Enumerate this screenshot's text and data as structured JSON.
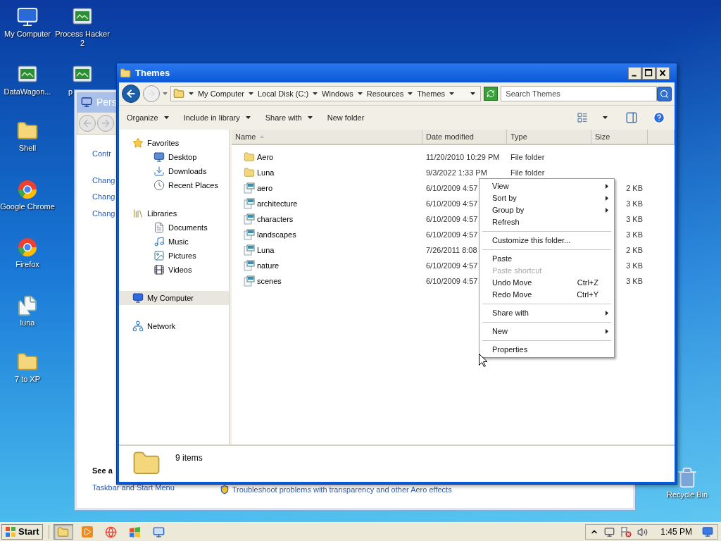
{
  "desktop_icons": [
    {
      "label": "My Computer",
      "kind": "computer"
    },
    {
      "label": "Process Hacker 2",
      "kind": "app"
    },
    {
      "label": "DataWagon...",
      "kind": "app"
    },
    {
      "label": "p",
      "kind": "app"
    },
    {
      "label": "Shell",
      "kind": "folder"
    },
    {
      "label": "Google Chrome",
      "kind": "browser"
    },
    {
      "label": "Firefox",
      "kind": "browser"
    },
    {
      "label": "luna",
      "kind": "files"
    },
    {
      "label": "7 to XP",
      "kind": "folder"
    },
    {
      "label": "Recycle Bin",
      "kind": "trash"
    }
  ],
  "back_window": {
    "title": "Pers",
    "links": [
      "Contr",
      "Chang",
      "Chang",
      "Chang"
    ],
    "see_also_heading": "See a",
    "see_also_link": "Taskbar and Start Menu",
    "troubleshoot_link": "Troubleshoot problems with transparency and other Aero effects"
  },
  "explorer": {
    "title": "Themes",
    "breadcrumb": [
      "My Computer",
      "Local Disk (C:)",
      "Windows",
      "Resources",
      "Themes"
    ],
    "search": {
      "placeholder": "Search Themes"
    },
    "toolbar": [
      {
        "label": "Organize",
        "dropdown": true
      },
      {
        "label": "Include in library",
        "dropdown": true
      },
      {
        "label": "Share with",
        "dropdown": true
      },
      {
        "label": "New folder",
        "dropdown": false
      }
    ],
    "nav": [
      {
        "label": "Favorites",
        "kind": "star",
        "selected": false,
        "children": [
          {
            "label": "Desktop",
            "kind": "desktop",
            "selected": false
          },
          {
            "label": "Downloads",
            "kind": "download",
            "selected": false
          },
          {
            "label": "Recent Places",
            "kind": "recent",
            "selected": false
          }
        ]
      },
      {
        "label": "Libraries",
        "kind": "library",
        "selected": false,
        "children": [
          {
            "label": "Documents",
            "kind": "document",
            "selected": false
          },
          {
            "label": "Music",
            "kind": "music",
            "selected": false
          },
          {
            "label": "Pictures",
            "kind": "picture",
            "selected": false
          },
          {
            "label": "Videos",
            "kind": "video",
            "selected": false
          }
        ]
      },
      {
        "label": "My Computer",
        "kind": "computer",
        "selected": true
      },
      {
        "label": "Network",
        "kind": "network",
        "selected": false
      }
    ],
    "columns": [
      "Name",
      "Date modified",
      "Type",
      "Size"
    ],
    "rows": [
      {
        "name": "Aero",
        "kind": "folder",
        "date": "11/20/2010 10:29 PM",
        "type": "File folder"
      },
      {
        "name": "Luna",
        "kind": "folder",
        "date": "9/3/2022 1:33 PM",
        "type": "File folder"
      },
      {
        "name": "aero",
        "kind": "theme",
        "date": "6/10/2009 4:57",
        "size": "2 KB"
      },
      {
        "name": "architecture",
        "kind": "theme",
        "date": "6/10/2009 4:57",
        "size": "3 KB"
      },
      {
        "name": "characters",
        "kind": "theme",
        "date": "6/10/2009 4:57",
        "size": "3 KB"
      },
      {
        "name": "landscapes",
        "kind": "theme",
        "date": "6/10/2009 4:57",
        "size": "3 KB"
      },
      {
        "name": "Luna",
        "kind": "theme",
        "date": "7/26/2011 8:08",
        "size": "2 KB"
      },
      {
        "name": "nature",
        "kind": "theme",
        "date": "6/10/2009 4:57",
        "size": "3 KB"
      },
      {
        "name": "scenes",
        "kind": "theme",
        "date": "6/10/2009 4:57",
        "size": "3 KB"
      }
    ],
    "status": "9 items"
  },
  "context_menu": [
    {
      "kind": "item",
      "label": "View",
      "submenu": true,
      "disabled": false
    },
    {
      "kind": "item",
      "label": "Sort by",
      "submenu": true,
      "disabled": false
    },
    {
      "kind": "item",
      "label": "Group by",
      "submenu": true,
      "disabled": false
    },
    {
      "kind": "item",
      "label": "Refresh",
      "submenu": false,
      "disabled": false
    },
    {
      "kind": "separator"
    },
    {
      "kind": "item",
      "label": "Customize this folder...",
      "submenu": false,
      "disabled": false
    },
    {
      "kind": "separator"
    },
    {
      "kind": "item",
      "label": "Paste",
      "submenu": false,
      "disabled": false
    },
    {
      "kind": "item",
      "label": "Paste shortcut",
      "submenu": false,
      "disabled": true
    },
    {
      "kind": "item",
      "label": "Undo Move",
      "shortcut": "Ctrl+Z",
      "submenu": false,
      "disabled": false
    },
    {
      "kind": "item",
      "label": "Redo Move",
      "shortcut": "Ctrl+Y",
      "submenu": false,
      "disabled": false
    },
    {
      "kind": "separator"
    },
    {
      "kind": "item",
      "label": "Share with",
      "submenu": true,
      "disabled": false
    },
    {
      "kind": "separator"
    },
    {
      "kind": "item",
      "label": "New",
      "submenu": true,
      "disabled": false
    },
    {
      "kind": "separator"
    },
    {
      "kind": "item",
      "label": "Properties",
      "submenu": false,
      "disabled": false
    }
  ],
  "taskbar": {
    "start": "Start",
    "apps": [
      {
        "kind": "folder",
        "selected": true
      },
      {
        "kind": "media",
        "selected": false
      },
      {
        "kind": "browser",
        "selected": false
      },
      {
        "kind": "windows",
        "selected": false
      },
      {
        "kind": "monitor",
        "selected": false
      }
    ],
    "clock": "1:45 PM"
  }
}
